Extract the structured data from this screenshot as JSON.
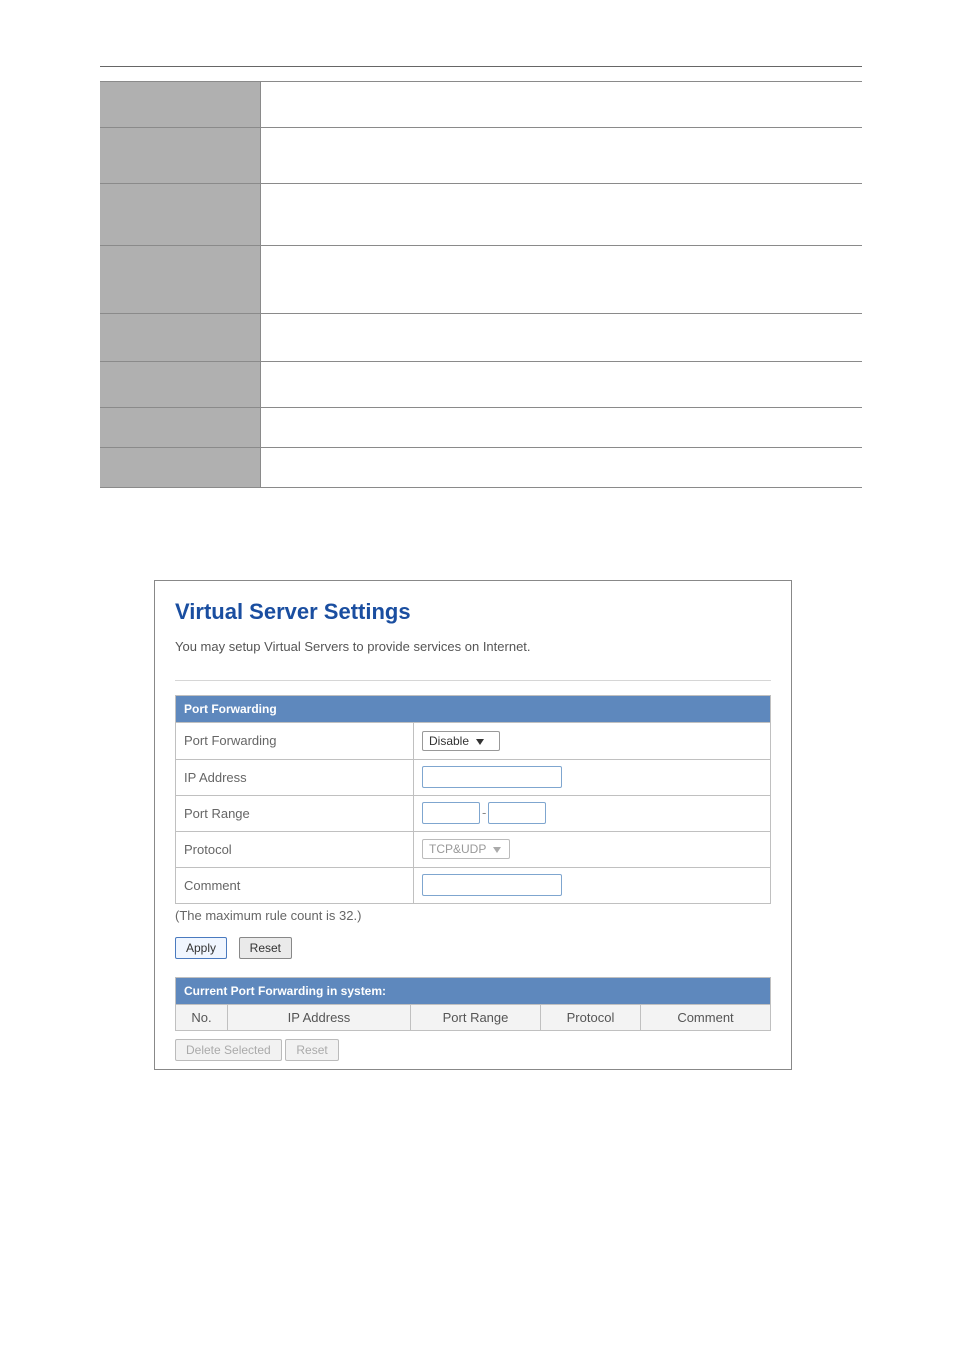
{
  "panel": {
    "title": "Virtual Server Settings",
    "description": "You may setup Virtual Servers to provide services on Internet."
  },
  "port_forwarding": {
    "header": "Port Forwarding",
    "rows": {
      "mode": {
        "label": "Port Forwarding",
        "value": "Disable"
      },
      "ip": {
        "label": "IP Address",
        "value": ""
      },
      "range": {
        "label": "Port Range",
        "from": "",
        "to": ""
      },
      "protocol": {
        "label": "Protocol",
        "value": "TCP&UDP"
      },
      "comment": {
        "label": "Comment",
        "value": ""
      }
    },
    "note": "(The maximum rule count is 32.)",
    "buttons": {
      "apply": "Apply",
      "reset": "Reset"
    }
  },
  "current": {
    "header": "Current Port Forwarding in system:",
    "columns": {
      "no": "No.",
      "ip": "IP Address",
      "range": "Port Range",
      "protocol": "Protocol",
      "comment": "Comment"
    },
    "buttons": {
      "delete": "Delete Selected",
      "reset": "Reset"
    }
  }
}
